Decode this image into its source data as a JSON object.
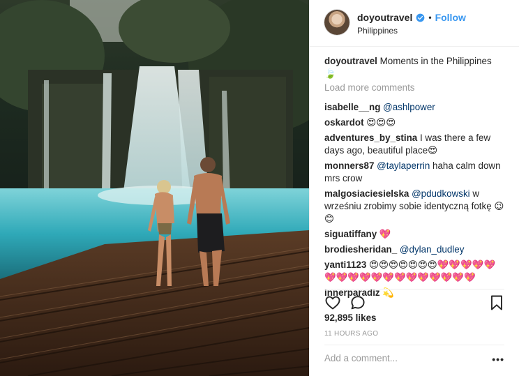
{
  "post": {
    "username": "doyoutravel",
    "follow_label": "Follow",
    "dot": "•",
    "location": "Philippines"
  },
  "caption": {
    "user": "doyoutravel",
    "text": " Moments in the Philippines 🍃"
  },
  "load_more": "Load more comments",
  "comments": [
    {
      "user": "isabelle__ng",
      "mention": " @ashlpower",
      "text": ""
    },
    {
      "user": "oskardot",
      "mention": "",
      "text": " 😍😍😍"
    },
    {
      "user": "adventures_by_stina",
      "mention": "",
      "text": " I was there a few days ago, beautiful place😍"
    },
    {
      "user": "monners87",
      "mention": " @taylaperrin",
      "text": " haha calm down mrs crow"
    },
    {
      "user": "malgosiaciesielska",
      "mention": " @pdudkowski",
      "text": " w wrześniu zrobimy sobie identyczną fotkę 😉😊"
    },
    {
      "user": "siguatiffany",
      "mention": "",
      "text": " 💖"
    },
    {
      "user": "brodiesheridan_",
      "mention": " @dylan_dudley",
      "text": ""
    },
    {
      "user": "yanti1123",
      "mention": "",
      "text": " 😍😍😍😍😍😍😍💖💖💖💖💖💖💖💖💖💖💖💖💖💖💖💖💖💖"
    },
    {
      "user": "innerparadiz",
      "mention": "",
      "text": " 💫"
    }
  ],
  "likes": "92,895 likes",
  "timestamp": "11 HOURS AGO",
  "add_comment_placeholder": "Add a comment...",
  "more_label": "•••",
  "icons": {
    "verified": "verified-badge-icon",
    "like": "heart-icon",
    "comment": "comment-icon",
    "save": "bookmark-icon"
  },
  "colors": {
    "link_blue": "#3897f0",
    "mention": "#003569",
    "muted": "#999999"
  }
}
